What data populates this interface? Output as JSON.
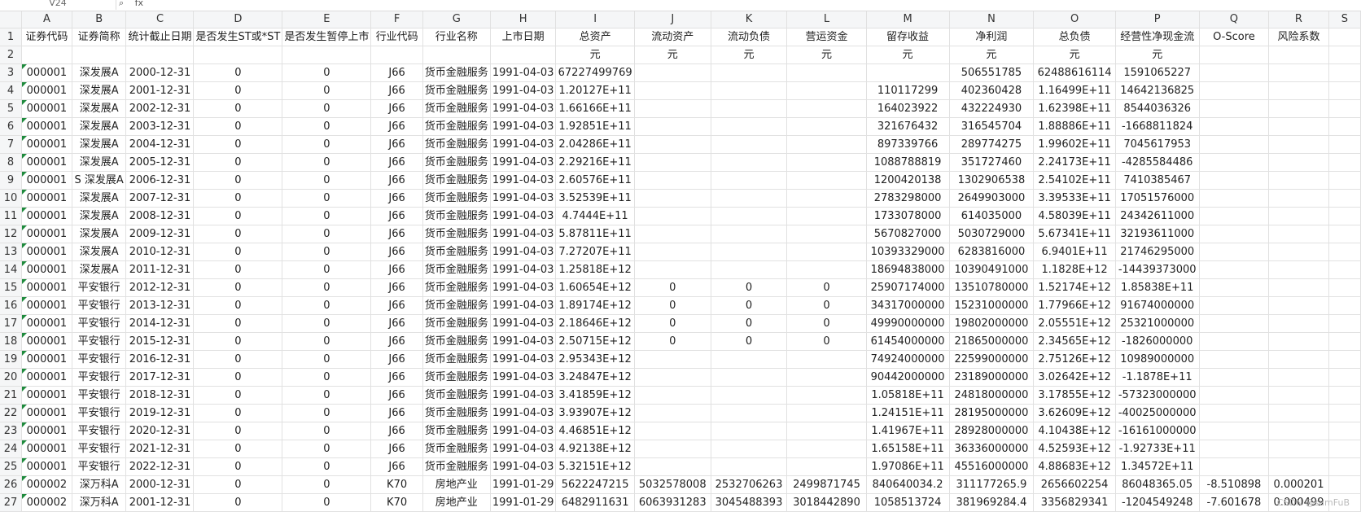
{
  "formula_bar": {
    "cell_ref": "V24",
    "zoom_icon": "magnifier-icon",
    "fx_label": "fx"
  },
  "columns": [
    "A",
    "B",
    "C",
    "D",
    "E",
    "F",
    "G",
    "H",
    "I",
    "J",
    "K",
    "L",
    "M",
    "N",
    "O",
    "P",
    "Q",
    "R",
    "S"
  ],
  "header_row": [
    "证券代码",
    "证券简称",
    "统计截止日期",
    "是否发生ST或*ST",
    "是否发生暂停上市",
    "行业代码",
    "行业名称",
    "上市日期",
    "总资产",
    "流动资产",
    "流动负债",
    "营运资金",
    "留存收益",
    "净利润",
    "总负债",
    "经营性净现金流",
    "O-Score",
    "风险系数",
    ""
  ],
  "unit_row": [
    "",
    "",
    "",
    "",
    "",
    "",
    "",
    "",
    "元",
    "元",
    "元",
    "元",
    "元",
    "元",
    "元",
    "元",
    "",
    "",
    ""
  ],
  "data_rows": [
    [
      "000001",
      "深发展A",
      "2000-12-31",
      "0",
      "0",
      "J66",
      "货币金融服务",
      "1991-04-03",
      "67227499769",
      "",
      "",
      "",
      "",
      "506551785",
      "62488616114",
      "1591065227",
      "",
      "",
      ""
    ],
    [
      "000001",
      "深发展A",
      "2001-12-31",
      "0",
      "0",
      "J66",
      "货币金融服务",
      "1991-04-03",
      "1.20127E+11",
      "",
      "",
      "",
      "110117299",
      "402360428",
      "1.16499E+11",
      "14642136825",
      "",
      "",
      ""
    ],
    [
      "000001",
      "深发展A",
      "2002-12-31",
      "0",
      "0",
      "J66",
      "货币金融服务",
      "1991-04-03",
      "1.66166E+11",
      "",
      "",
      "",
      "164023922",
      "432224930",
      "1.62398E+11",
      "8544036326",
      "",
      "",
      ""
    ],
    [
      "000001",
      "深发展A",
      "2003-12-31",
      "0",
      "0",
      "J66",
      "货币金融服务",
      "1991-04-03",
      "1.92851E+11",
      "",
      "",
      "",
      "321676432",
      "316545704",
      "1.88886E+11",
      "-1668811824",
      "",
      "",
      ""
    ],
    [
      "000001",
      "深发展A",
      "2004-12-31",
      "0",
      "0",
      "J66",
      "货币金融服务",
      "1991-04-03",
      "2.04286E+11",
      "",
      "",
      "",
      "897339766",
      "289774275",
      "1.99602E+11",
      "7045617953",
      "",
      "",
      ""
    ],
    [
      "000001",
      "深发展A",
      "2005-12-31",
      "0",
      "0",
      "J66",
      "货币金融服务",
      "1991-04-03",
      "2.29216E+11",
      "",
      "",
      "",
      "1088788819",
      "351727460",
      "2.24173E+11",
      "-4285584486",
      "",
      "",
      ""
    ],
    [
      "000001",
      "S 深发展A",
      "2006-12-31",
      "0",
      "0",
      "J66",
      "货币金融服务",
      "1991-04-03",
      "2.60576E+11",
      "",
      "",
      "",
      "1200420138",
      "1302906538",
      "2.54102E+11",
      "7410385467",
      "",
      "",
      ""
    ],
    [
      "000001",
      "深发展A",
      "2007-12-31",
      "0",
      "0",
      "J66",
      "货币金融服务",
      "1991-04-03",
      "3.52539E+11",
      "",
      "",
      "",
      "2783298000",
      "2649903000",
      "3.39533E+11",
      "17051576000",
      "",
      "",
      ""
    ],
    [
      "000001",
      "深发展A",
      "2008-12-31",
      "0",
      "0",
      "J66",
      "货币金融服务",
      "1991-04-03",
      "4.7444E+11",
      "",
      "",
      "",
      "1733078000",
      "614035000",
      "4.58039E+11",
      "24342611000",
      "",
      "",
      ""
    ],
    [
      "000001",
      "深发展A",
      "2009-12-31",
      "0",
      "0",
      "J66",
      "货币金融服务",
      "1991-04-03",
      "5.87811E+11",
      "",
      "",
      "",
      "5670827000",
      "5030729000",
      "5.67341E+11",
      "32193611000",
      "",
      "",
      ""
    ],
    [
      "000001",
      "深发展A",
      "2010-12-31",
      "0",
      "0",
      "J66",
      "货币金融服务",
      "1991-04-03",
      "7.27207E+11",
      "",
      "",
      "",
      "10393329000",
      "6283816000",
      "6.9401E+11",
      "21746295000",
      "",
      "",
      ""
    ],
    [
      "000001",
      "深发展A",
      "2011-12-31",
      "0",
      "0",
      "J66",
      "货币金融服务",
      "1991-04-03",
      "1.25818E+12",
      "",
      "",
      "",
      "18694838000",
      "10390491000",
      "1.1828E+12",
      "-14439373000",
      "",
      "",
      ""
    ],
    [
      "000001",
      "平安银行",
      "2012-12-31",
      "0",
      "0",
      "J66",
      "货币金融服务",
      "1991-04-03",
      "1.60654E+12",
      "0",
      "0",
      "0",
      "25907174000",
      "13510780000",
      "1.52174E+12",
      "1.85838E+11",
      "",
      "",
      ""
    ],
    [
      "000001",
      "平安银行",
      "2013-12-31",
      "0",
      "0",
      "J66",
      "货币金融服务",
      "1991-04-03",
      "1.89174E+12",
      "0",
      "0",
      "0",
      "34317000000",
      "15231000000",
      "1.77966E+12",
      "91674000000",
      "",
      "",
      ""
    ],
    [
      "000001",
      "平安银行",
      "2014-12-31",
      "0",
      "0",
      "J66",
      "货币金融服务",
      "1991-04-03",
      "2.18646E+12",
      "0",
      "0",
      "0",
      "49990000000",
      "19802000000",
      "2.05551E+12",
      "25321000000",
      "",
      "",
      ""
    ],
    [
      "000001",
      "平安银行",
      "2015-12-31",
      "0",
      "0",
      "J66",
      "货币金融服务",
      "1991-04-03",
      "2.50715E+12",
      "0",
      "0",
      "0",
      "61454000000",
      "21865000000",
      "2.34565E+12",
      "-1826000000",
      "",
      "",
      ""
    ],
    [
      "000001",
      "平安银行",
      "2016-12-31",
      "0",
      "0",
      "J66",
      "货币金融服务",
      "1991-04-03",
      "2.95343E+12",
      "",
      "",
      "",
      "74924000000",
      "22599000000",
      "2.75126E+12",
      "10989000000",
      "",
      "",
      ""
    ],
    [
      "000001",
      "平安银行",
      "2017-12-31",
      "0",
      "0",
      "J66",
      "货币金融服务",
      "1991-04-03",
      "3.24847E+12",
      "",
      "",
      "",
      "90442000000",
      "23189000000",
      "3.02642E+12",
      "-1.1878E+11",
      "",
      "",
      ""
    ],
    [
      "000001",
      "平安银行",
      "2018-12-31",
      "0",
      "0",
      "J66",
      "货币金融服务",
      "1991-04-03",
      "3.41859E+12",
      "",
      "",
      "",
      "1.05818E+11",
      "24818000000",
      "3.17855E+12",
      "-57323000000",
      "",
      "",
      ""
    ],
    [
      "000001",
      "平安银行",
      "2019-12-31",
      "0",
      "0",
      "J66",
      "货币金融服务",
      "1991-04-03",
      "3.93907E+12",
      "",
      "",
      "",
      "1.24151E+11",
      "28195000000",
      "3.62609E+12",
      "-40025000000",
      "",
      "",
      ""
    ],
    [
      "000001",
      "平安银行",
      "2020-12-31",
      "0",
      "0",
      "J66",
      "货币金融服务",
      "1991-04-03",
      "4.46851E+12",
      "",
      "",
      "",
      "1.41967E+11",
      "28928000000",
      "4.10438E+12",
      "-16161000000",
      "",
      "",
      ""
    ],
    [
      "000001",
      "平安银行",
      "2021-12-31",
      "0",
      "0",
      "J66",
      "货币金融服务",
      "1991-04-03",
      "4.92138E+12",
      "",
      "",
      "",
      "1.65158E+11",
      "36336000000",
      "4.52593E+12",
      "-1.92733E+11",
      "",
      "",
      ""
    ],
    [
      "000001",
      "平安银行",
      "2022-12-31",
      "0",
      "0",
      "J66",
      "货币金融服务",
      "1991-04-03",
      "5.32151E+12",
      "",
      "",
      "",
      "1.97086E+11",
      "45516000000",
      "4.88683E+12",
      "1.34572E+11",
      "",
      "",
      ""
    ],
    [
      "000002",
      "深万科A",
      "2000-12-31",
      "0",
      "0",
      "K70",
      "房地产业",
      "1991-01-29",
      "5622247215",
      "5032578008",
      "2532706263",
      "2499871745",
      "840640034.2",
      "311177265.9",
      "2656602254",
      "86048365.05",
      "-8.510898",
      "0.000201",
      ""
    ],
    [
      "000002",
      "深万科A",
      "2001-12-31",
      "0",
      "0",
      "K70",
      "房地产业",
      "1991-01-29",
      "6482911631",
      "6063931283",
      "3045488393",
      "3018442890",
      "1058513724",
      "381969284.4",
      "3356829341",
      "-1204549248",
      "-7.601678",
      "0.000499",
      ""
    ]
  ],
  "watermark": "CSDN @samFuB"
}
